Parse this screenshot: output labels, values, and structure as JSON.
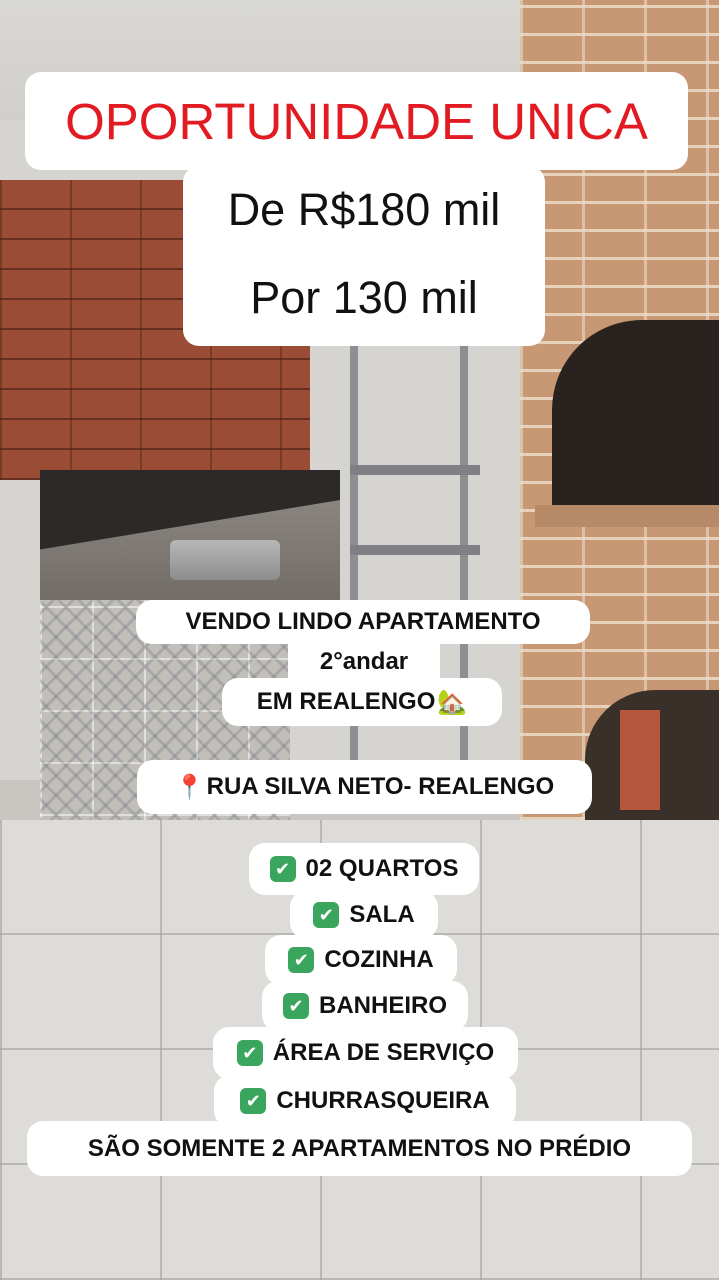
{
  "headline": "OPORTUNIDADE UNICA",
  "price": {
    "from": "De R$180 mil",
    "to": "Por 130 mil"
  },
  "listing": {
    "line1": "VENDO LINDO APARTAMENTO",
    "line2": "2°andar",
    "line3": "EM REALENGO",
    "house_emoji": "🏡",
    "address_icon": "📍",
    "address": "RUA SILVA NETO- REALENGO"
  },
  "features": {
    "check_icon": "✔",
    "items": [
      "02 QUARTOS",
      "SALA",
      "COZINHA",
      "BANHEIRO",
      "ÁREA DE SERVIÇO",
      "CHURRASQUEIRA"
    ]
  },
  "footer": "SÃO SOMENTE 2 APARTAMENTOS NO PRÉDIO"
}
